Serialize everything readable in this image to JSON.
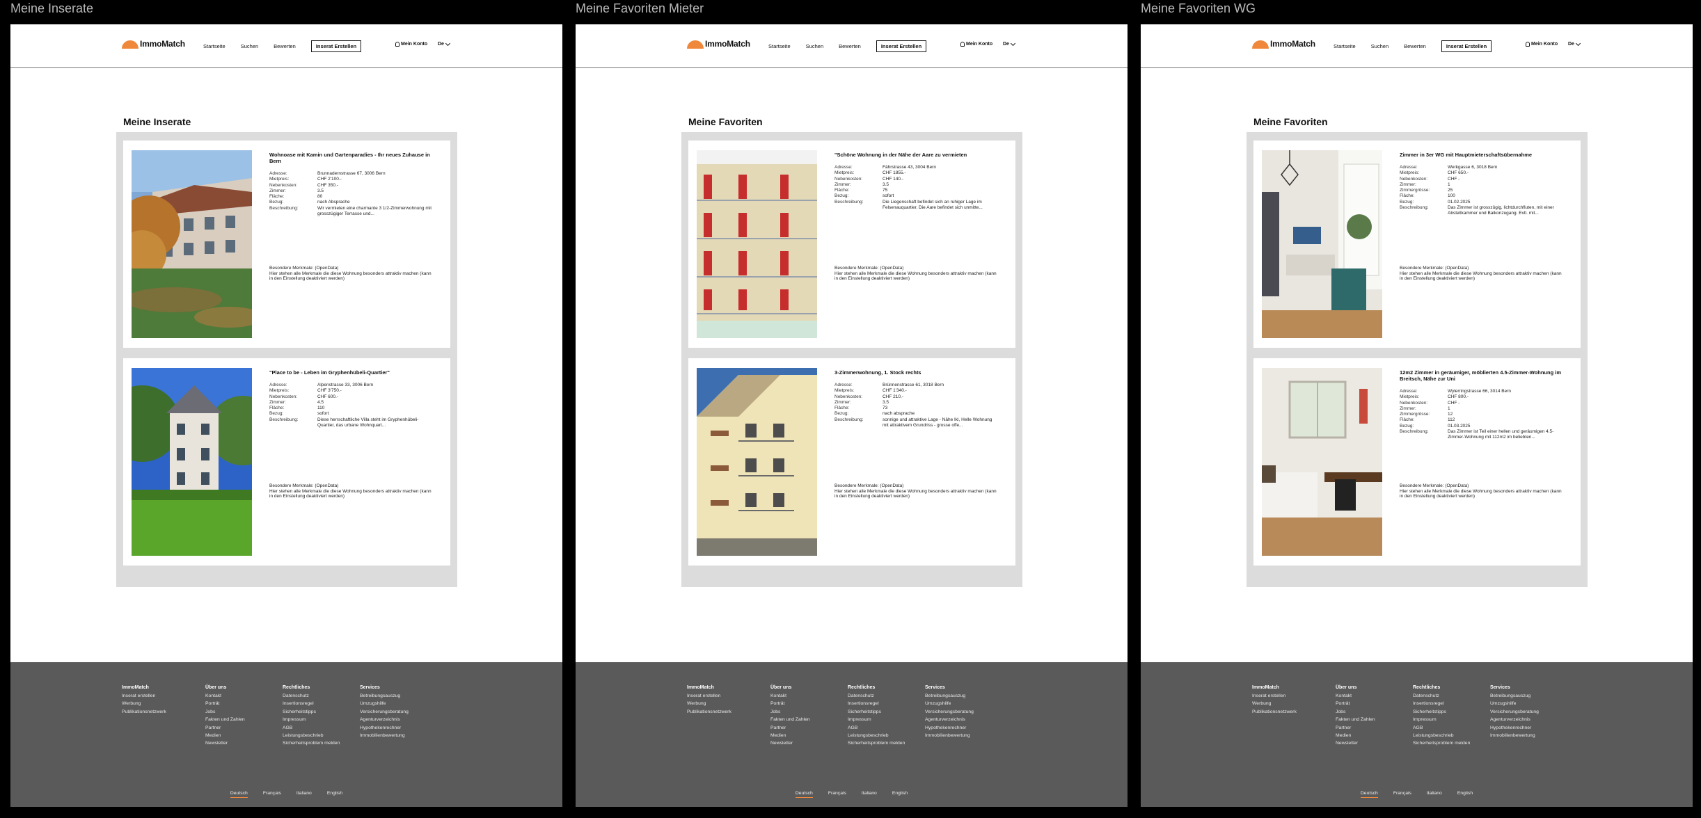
{
  "frames": [
    {
      "label": "Meine Inserate",
      "page_title": "Meine Inserate",
      "cards": [
        {
          "image": "house-garden-autumn-photo",
          "title": "Wohnoase mit Kamin und Gartenparadies - Ihr neues Zuhause in Bern",
          "rows": [
            {
              "k": "Adresse:",
              "v": "Brunnadernstrasse 67, 3006 Bern"
            },
            {
              "k": "Mietpreis:",
              "v": "CHF 2'100.-"
            },
            {
              "k": "Nebenkosten:",
              "v": "CHF 350.-"
            },
            {
              "k": "Zimmer:",
              "v": "3.5"
            },
            {
              "k": "Fläche:",
              "v": "80"
            },
            {
              "k": "Bezug:",
              "v": "nach Absprache"
            },
            {
              "k": "Beschreibung:",
              "v": "Wir vermieten eine charmante 3 1/2-Zimmerwohnung mit grosszügiger Terrasse und..."
            }
          ],
          "merkmale_title": "Besondere Merkmale: (OpenData)",
          "merkmale_text": "Hier stehen alle Merkmale die diese Wohnung besonders attraktiv machen (kann in den Einstellung deaktiviert werden)"
        },
        {
          "image": "villa-lawn-photo",
          "title": "\"Place to be - Leben im Gryphenhübeli-Quartier\"",
          "rows": [
            {
              "k": "Adresse:",
              "v": "Alpenstrasse 33, 3006 Bern"
            },
            {
              "k": "Mietpreis:",
              "v": "CHF 3'750.-"
            },
            {
              "k": "Nebenkosten:",
              "v": "CHF 600.-"
            },
            {
              "k": "Zimmer:",
              "v": "4.5"
            },
            {
              "k": "Fläche:",
              "v": "110"
            },
            {
              "k": "Bezug:",
              "v": "sofort"
            },
            {
              "k": "Beschreibung:",
              "v": "Diese herrschaftliche Villa steht im Gryphenhübeli-Quartier, das urbane Wohnquart..."
            }
          ],
          "merkmale_title": "Besondere Merkmale: (OpenData)",
          "merkmale_text": "Hier stehen alle Merkmale die diese Wohnung besonders attraktiv machen (kann in den Einstellung deaktiviert werden)"
        }
      ]
    },
    {
      "label": "Meine Favoriten Mieter",
      "page_title": "Meine Favoriten",
      "cards": [
        {
          "image": "apartment-balconies-red-shutters-photo",
          "title": "\"Schöne Wohnung in der Nähe der Aare zu vermieten",
          "rows": [
            {
              "k": "Adresse:",
              "v": "Fährstrasse 43, 3004 Bern"
            },
            {
              "k": "Mietpreis:",
              "v": "CHF 1855.-"
            },
            {
              "k": "Nebenkosten:",
              "v": "CHF 140.-"
            },
            {
              "k": "Zimmer:",
              "v": "3.5"
            },
            {
              "k": "Fläche:",
              "v": "75"
            },
            {
              "k": "Bezug:",
              "v": "sofort"
            },
            {
              "k": "Beschreibung:",
              "v": "Die Liegenschaft befindet sich an ruhiger Lage im Felsenauquartier. Die Aare befindet sich unmitte..."
            }
          ],
          "merkmale_title": "Besondere Merkmale: (OpenData)",
          "merkmale_text": "Hier stehen alle Merkmale die diese Wohnung besonders attraktiv machen (kann in den Einstellung deaktiviert werden)"
        },
        {
          "image": "apartment-building-balconies-photo",
          "title": "3-Zimmerwohnung, 1. Stock rechts",
          "rows": [
            {
              "k": "Adresse:",
              "v": "Brünnenstrasse 61, 3018 Bern"
            },
            {
              "k": "Mietpreis:",
              "v": "CHF 1'340.-"
            },
            {
              "k": "Nebenkosten:",
              "v": "CHF 210.-"
            },
            {
              "k": "Zimmer:",
              "v": "3.5"
            },
            {
              "k": "Fläche:",
              "v": "73"
            },
            {
              "k": "Bezug:",
              "v": "nach absprache"
            },
            {
              "k": "Beschreibung:",
              "v": "sonnige und attraktive Lage - Nähe Ikl, Helle Wohnung mit attraktivem Grundriss - grosse offe..."
            }
          ],
          "merkmale_title": "Besondere Merkmale: (OpenData)",
          "merkmale_text": "Hier stehen alle Merkmale die diese Wohnung besonders attraktiv machen (kann in den Einstellung deaktiviert werden)"
        }
      ]
    },
    {
      "label": "Meine Favoriten WG",
      "page_title": "Meine Favoriten",
      "cards": [
        {
          "image": "wg-room-interior-photo",
          "title": "Zimmer in 3er WG mit Hauptmieterschaftsübernahme",
          "rows": [
            {
              "k": "Adresse:",
              "v": "Werkgasse 6, 3018 Bern"
            },
            {
              "k": "Mietpreis:",
              "v": "CHF 650.-"
            },
            {
              "k": "Nebenkosten:",
              "v": "CHF -"
            },
            {
              "k": "Zimmer:",
              "v": "1"
            },
            {
              "k": "Zimmergrösse:",
              "v": "25"
            },
            {
              "k": "Fläche:",
              "v": "100"
            },
            {
              "k": "Bezug:",
              "v": "01.02.2025"
            },
            {
              "k": "Beschreibung:",
              "v": "Das Zimmer ist grosszügig, lichtdurchfluten, mit einer Abstellkammer und Balkonzugang. Evtl. mit..."
            }
          ],
          "merkmale_title": "Besondere Merkmale: (OpenData)",
          "merkmale_text": "Hier stehen alle Merkmale die diese Wohnung besonders attraktiv machen (kann in den Einstellung deaktiviert werden)"
        },
        {
          "image": "furnished-room-bed-desk-photo",
          "title": "12m2 Zimmer in geräumiger, möblierten 4.5-Zimmer-Wohnung im Breitsch, Nähe zur Uni",
          "rows": [
            {
              "k": "Adresse:",
              "v": "Wylerringstrasse 66, 3014 Bern"
            },
            {
              "k": "Mietpreis:",
              "v": "CHF 800.-"
            },
            {
              "k": "Nebenkosten:",
              "v": "CHF -"
            },
            {
              "k": "Zimmer:",
              "v": "1"
            },
            {
              "k": "Zimmergrösse:",
              "v": "12"
            },
            {
              "k": "Fläche:",
              "v": "112"
            },
            {
              "k": "Bezug:",
              "v": "01.03.2025"
            },
            {
              "k": "Beschreibung:",
              "v": "Das Zimmer ist Teil einer hellen und geräumigen 4.5-Zimmer-Wohnung mit 112m2 im beliebten..."
            }
          ],
          "merkmale_title": "Besondere Merkmale: (OpenData)",
          "merkmale_text": "Hier stehen alle Merkmale die diese Wohnung besonders attraktiv machen (kann in den Einstellung deaktiviert werden)"
        }
      ]
    }
  ],
  "header": {
    "logo_text": "ImmoMatch",
    "nav": [
      "Startseite",
      "Suchen",
      "Bewerten"
    ],
    "cta": "Inserat Erstellen",
    "account": "Mein Konto",
    "language": "De",
    "icons": {
      "account": "person-icon",
      "language": "chevron-down-icon"
    }
  },
  "footer": {
    "columns": [
      {
        "heading": "ImmoMatch",
        "items": [
          "Inserat erstellen",
          "Werbung",
          "Publikationsnetzwerk"
        ]
      },
      {
        "heading": "Über uns",
        "items": [
          "Kontakt",
          "Porträt",
          "Jobs",
          "Fakten und Zahlen",
          "Partner",
          "Medien",
          "Newsletter"
        ]
      },
      {
        "heading": "Rechtliches",
        "items": [
          "Datenschutz",
          "Insertionsregel",
          "Sicherheitstipps",
          "Impressum",
          "AGB",
          "Leistungsbeschrieb",
          "Sicherheitsproblem melden"
        ]
      },
      {
        "heading": "Services",
        "items": [
          "Betreibungsauszug",
          "Umzugshilfe",
          "Versicherungsberatung",
          "Agenturverzeichnis",
          "Hypothekenrechner",
          "Immobilienbewertung"
        ]
      }
    ],
    "languages": [
      "Deutsch",
      "Français",
      "Italiano",
      "English"
    ],
    "active_language": "Deutsch"
  },
  "colors": {
    "accent": "#f0883b",
    "footer_bg": "#5a5a5a",
    "panel_bg": "#dcdcdc"
  }
}
